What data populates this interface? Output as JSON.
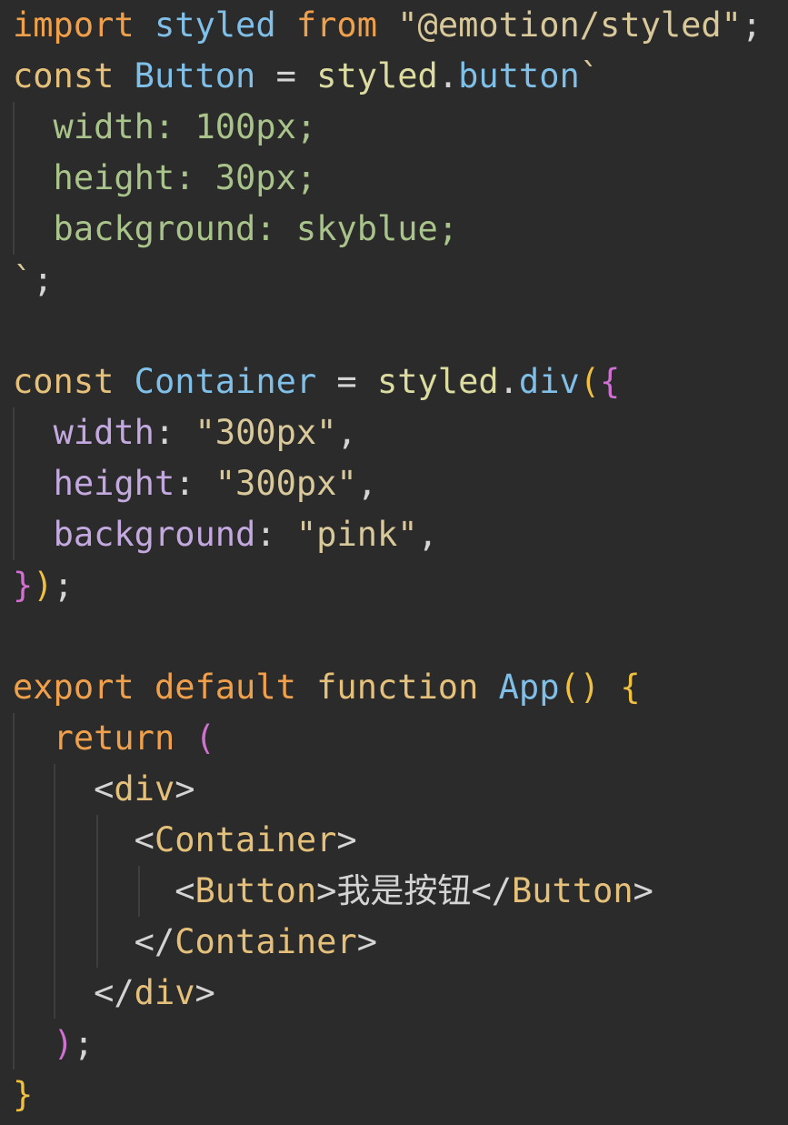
{
  "colors": {
    "background": "#2b2b2b",
    "keyword": "#e5c07b",
    "keyword_orange": "#f0a04b",
    "identifier_blue": "#7fbfe8",
    "function_green": "#dcdca0",
    "property_green": "#a9c48a",
    "property_purple": "#c4a9e0",
    "string": "#d9c89a",
    "punct": "#d4d4d4",
    "paren_pink": "#d070d0",
    "brace_yellow": "#f0c040",
    "tag": "#7fbfe8",
    "component": "#e5c07b",
    "indent_guide": "#3e3e3e"
  },
  "code_lines": [
    [
      {
        "t": "import",
        "c": "keyword_orange"
      },
      {
        "t": " ",
        "c": "punct"
      },
      {
        "t": "styled",
        "c": "identifier_blue"
      },
      {
        "t": " ",
        "c": "punct"
      },
      {
        "t": "from",
        "c": "keyword_orange"
      },
      {
        "t": " ",
        "c": "punct"
      },
      {
        "t": "\"@emotion/styled\"",
        "c": "string"
      },
      {
        "t": ";",
        "c": "punct"
      }
    ],
    [
      {
        "t": "const",
        "c": "keyword"
      },
      {
        "t": " ",
        "c": "punct"
      },
      {
        "t": "Button",
        "c": "identifier_blue"
      },
      {
        "t": " = ",
        "c": "punct"
      },
      {
        "t": "styled",
        "c": "function_green"
      },
      {
        "t": ".",
        "c": "punct"
      },
      {
        "t": "button",
        "c": "identifier_blue"
      },
      {
        "t": "`",
        "c": "string"
      }
    ],
    [
      {
        "t": "  width: 100px;",
        "c": "property_green"
      }
    ],
    [
      {
        "t": "  height: 30px;",
        "c": "property_green"
      }
    ],
    [
      {
        "t": "  background: skyblue;",
        "c": "property_green"
      }
    ],
    [
      {
        "t": "`",
        "c": "string"
      },
      {
        "t": ";",
        "c": "punct"
      }
    ],
    [],
    [
      {
        "t": "const",
        "c": "keyword"
      },
      {
        "t": " ",
        "c": "punct"
      },
      {
        "t": "Container",
        "c": "identifier_blue"
      },
      {
        "t": " = ",
        "c": "punct"
      },
      {
        "t": "styled",
        "c": "function_green"
      },
      {
        "t": ".",
        "c": "punct"
      },
      {
        "t": "div",
        "c": "identifier_blue"
      },
      {
        "t": "(",
        "c": "brace_yellow"
      },
      {
        "t": "{",
        "c": "paren_pink"
      }
    ],
    [
      {
        "t": "  ",
        "c": "punct"
      },
      {
        "t": "width",
        "c": "property_purple"
      },
      {
        "t": ": ",
        "c": "punct"
      },
      {
        "t": "\"300px\"",
        "c": "string"
      },
      {
        "t": ",",
        "c": "punct"
      }
    ],
    [
      {
        "t": "  ",
        "c": "punct"
      },
      {
        "t": "height",
        "c": "property_purple"
      },
      {
        "t": ": ",
        "c": "punct"
      },
      {
        "t": "\"300px\"",
        "c": "string"
      },
      {
        "t": ",",
        "c": "punct"
      }
    ],
    [
      {
        "t": "  ",
        "c": "punct"
      },
      {
        "t": "background",
        "c": "property_purple"
      },
      {
        "t": ": ",
        "c": "punct"
      },
      {
        "t": "\"pink\"",
        "c": "string"
      },
      {
        "t": ",",
        "c": "punct"
      }
    ],
    [
      {
        "t": "}",
        "c": "paren_pink"
      },
      {
        "t": ")",
        "c": "brace_yellow"
      },
      {
        "t": ";",
        "c": "punct"
      }
    ],
    [],
    [
      {
        "t": "export",
        "c": "keyword_orange"
      },
      {
        "t": " ",
        "c": "punct"
      },
      {
        "t": "default",
        "c": "keyword_orange"
      },
      {
        "t": " ",
        "c": "punct"
      },
      {
        "t": "function",
        "c": "keyword"
      },
      {
        "t": " ",
        "c": "punct"
      },
      {
        "t": "App",
        "c": "identifier_blue"
      },
      {
        "t": "()",
        "c": "brace_yellow"
      },
      {
        "t": " ",
        "c": "punct"
      },
      {
        "t": "{",
        "c": "brace_yellow"
      }
    ],
    [
      {
        "t": "  ",
        "c": "punct"
      },
      {
        "t": "return",
        "c": "keyword_orange"
      },
      {
        "t": " ",
        "c": "punct"
      },
      {
        "t": "(",
        "c": "paren_pink"
      }
    ],
    [
      {
        "t": "    ",
        "c": "punct"
      },
      {
        "t": "<",
        "c": "punct"
      },
      {
        "t": "div",
        "c": "component"
      },
      {
        "t": ">",
        "c": "punct"
      }
    ],
    [
      {
        "t": "      ",
        "c": "punct"
      },
      {
        "t": "<",
        "c": "punct"
      },
      {
        "t": "Container",
        "c": "component"
      },
      {
        "t": ">",
        "c": "punct"
      }
    ],
    [
      {
        "t": "        ",
        "c": "punct"
      },
      {
        "t": "<",
        "c": "punct"
      },
      {
        "t": "Button",
        "c": "component"
      },
      {
        "t": ">",
        "c": "punct"
      },
      {
        "t": "我是按钮",
        "c": "punct"
      },
      {
        "t": "</",
        "c": "punct"
      },
      {
        "t": "Button",
        "c": "component"
      },
      {
        "t": ">",
        "c": "punct"
      }
    ],
    [
      {
        "t": "      ",
        "c": "punct"
      },
      {
        "t": "</",
        "c": "punct"
      },
      {
        "t": "Container",
        "c": "component"
      },
      {
        "t": ">",
        "c": "punct"
      }
    ],
    [
      {
        "t": "    ",
        "c": "punct"
      },
      {
        "t": "</",
        "c": "punct"
      },
      {
        "t": "div",
        "c": "component"
      },
      {
        "t": ">",
        "c": "punct"
      }
    ],
    [
      {
        "t": "  ",
        "c": "punct"
      },
      {
        "t": ")",
        "c": "paren_pink"
      },
      {
        "t": ";",
        "c": "punct"
      }
    ],
    [
      {
        "t": "}",
        "c": "brace_yellow"
      }
    ]
  ]
}
